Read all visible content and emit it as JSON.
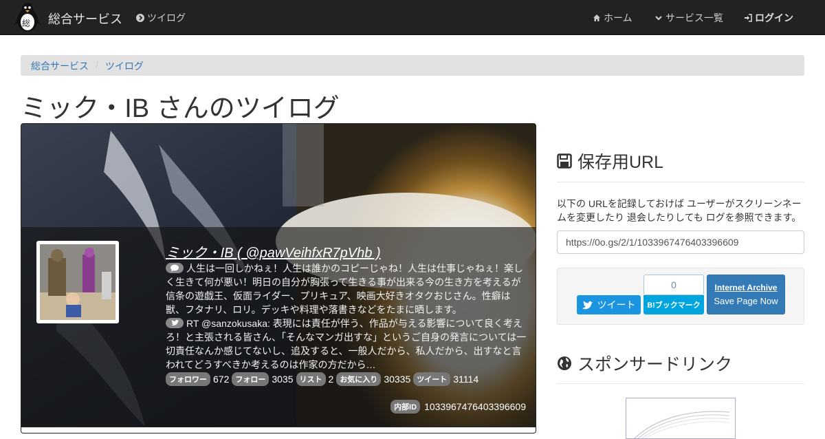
{
  "navbar": {
    "brand": "総合サービス",
    "logo_char": "総",
    "left_link": "ツイログ",
    "home": "ホーム",
    "services": "サービス一覧",
    "login": "ログイン"
  },
  "breadcrumb": [
    "総合サービス",
    "ツイログ"
  ],
  "page_title": "ミック・IB さんのツイログ",
  "profile": {
    "name": "ミック・IB ( @pawVeihfxR7pVhb )",
    "bio": "人生は一回しかねぇ！人生は誰かのコピーじゃね！人生は仕事じゃねぇ！楽しく生きて何が悪い！明日の自分が胸張って生きる事が出来る今の生き方を考えるが信条の遊戯王、仮面ライダー、プリキュア、映画大好きオタクおじさん。性癖は獣、フタナリ、ロリ。デッキや料理や落書きなどをたまに晒します。",
    "latest_tweet": "RT @sanzokusaka: 表現には責任が伴う、作品が与える影響について良く考えろ！と主張される皆さん、「そんなマンガ出すな」というご自身の発言については一切責任なんか感じてないし、追及すると、一般人だから、私人だから、出すなと言われてどうすべきか考えるのは作家の方だから…",
    "stats": [
      {
        "label": "フォロワー",
        "value": "672"
      },
      {
        "label": "フォロー",
        "value": "3035"
      },
      {
        "label": "リスト",
        "value": "2"
      },
      {
        "label": "お気に入り",
        "value": "30335"
      },
      {
        "label": "ツイート",
        "value": "31114"
      }
    ],
    "internal_id_label": "内部ID",
    "internal_id": "1033967476403396609"
  },
  "save_url": {
    "heading": "保存用URL",
    "description": "以下の URLを記録しておけば ユーザーがスクリーンネームを変更したり 退会したりしても ログを参照できます。",
    "url": "https://0o.gs/2/1/1033967476403396609"
  },
  "share": {
    "tweet": "ツイート",
    "hatena_count": "0",
    "hatena_label": "B!ブックマーク",
    "ia_title": "Internet Archive",
    "ia_sub": "Save Page Now"
  },
  "sponsored": {
    "heading": "スポンサードリンク"
  }
}
